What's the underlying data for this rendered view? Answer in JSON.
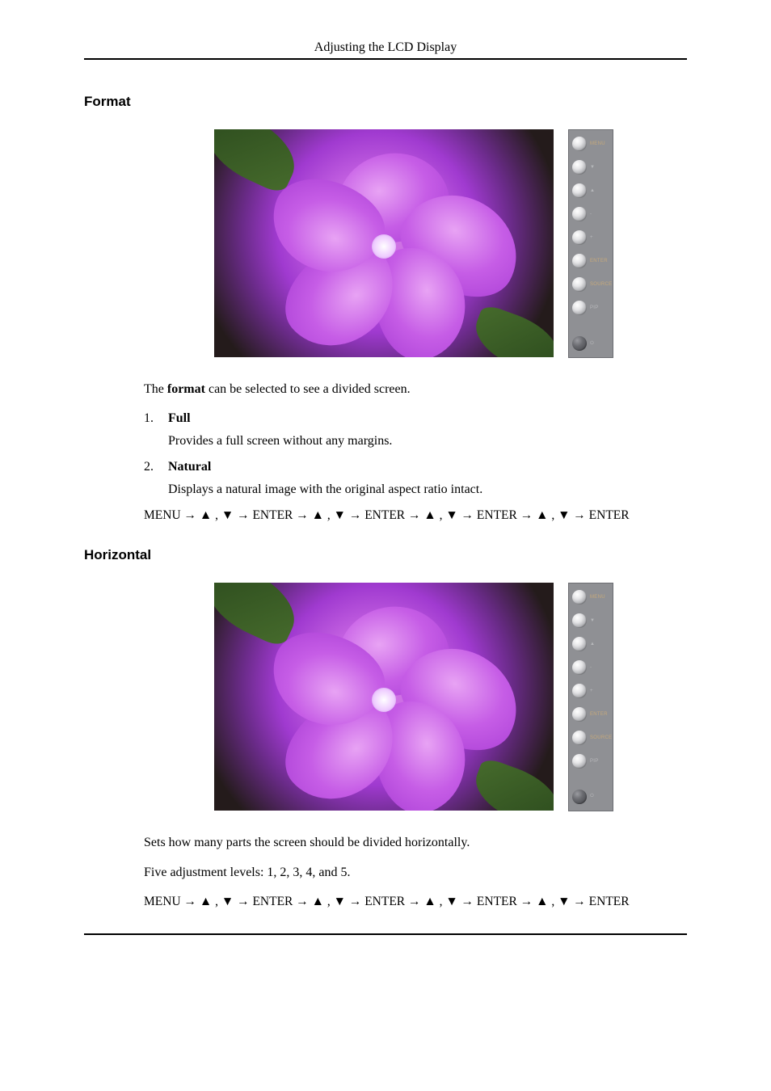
{
  "header": {
    "title": "Adjusting the LCD Display"
  },
  "panel_buttons": [
    {
      "label": "MENU",
      "labelClass": ""
    },
    {
      "label": "▼",
      "labelClass": "dim"
    },
    {
      "label": "▲",
      "labelClass": "dim"
    },
    {
      "label": "-",
      "labelClass": "dim"
    },
    {
      "label": "+",
      "labelClass": "dim"
    },
    {
      "label": "ENTER",
      "labelClass": ""
    },
    {
      "label": "SOURCE",
      "labelClass": ""
    },
    {
      "label": "PIP",
      "labelClass": "dim"
    }
  ],
  "panel_power": {
    "label": "⏻",
    "labelClass": "dim"
  },
  "sections": {
    "format": {
      "heading": "Format",
      "intro_pre": "The ",
      "intro_bold": "format",
      "intro_post": " can be selected to see a divided screen.",
      "items": [
        {
          "num": "1.",
          "label": "Full",
          "desc": "Provides a full screen without any margins."
        },
        {
          "num": "2.",
          "label": "Natural",
          "desc": "Displays a natural image with the original aspect ratio intact."
        }
      ],
      "menu_path": "MENU → ▲ , ▼ → ENTER → ▲ , ▼ → ENTER → ▲ , ▼ → ENTER → ▲ , ▼ → ENTER"
    },
    "horizontal": {
      "heading": "Horizontal",
      "p1": "Sets how many parts the screen should be divided horizontally.",
      "p2": "Five adjustment levels: 1, 2, 3, 4, and 5.",
      "menu_path": "MENU → ▲ , ▼ → ENTER → ▲ , ▼ → ENTER → ▲ , ▼ → ENTER → ▲ , ▼ → ENTER"
    }
  }
}
